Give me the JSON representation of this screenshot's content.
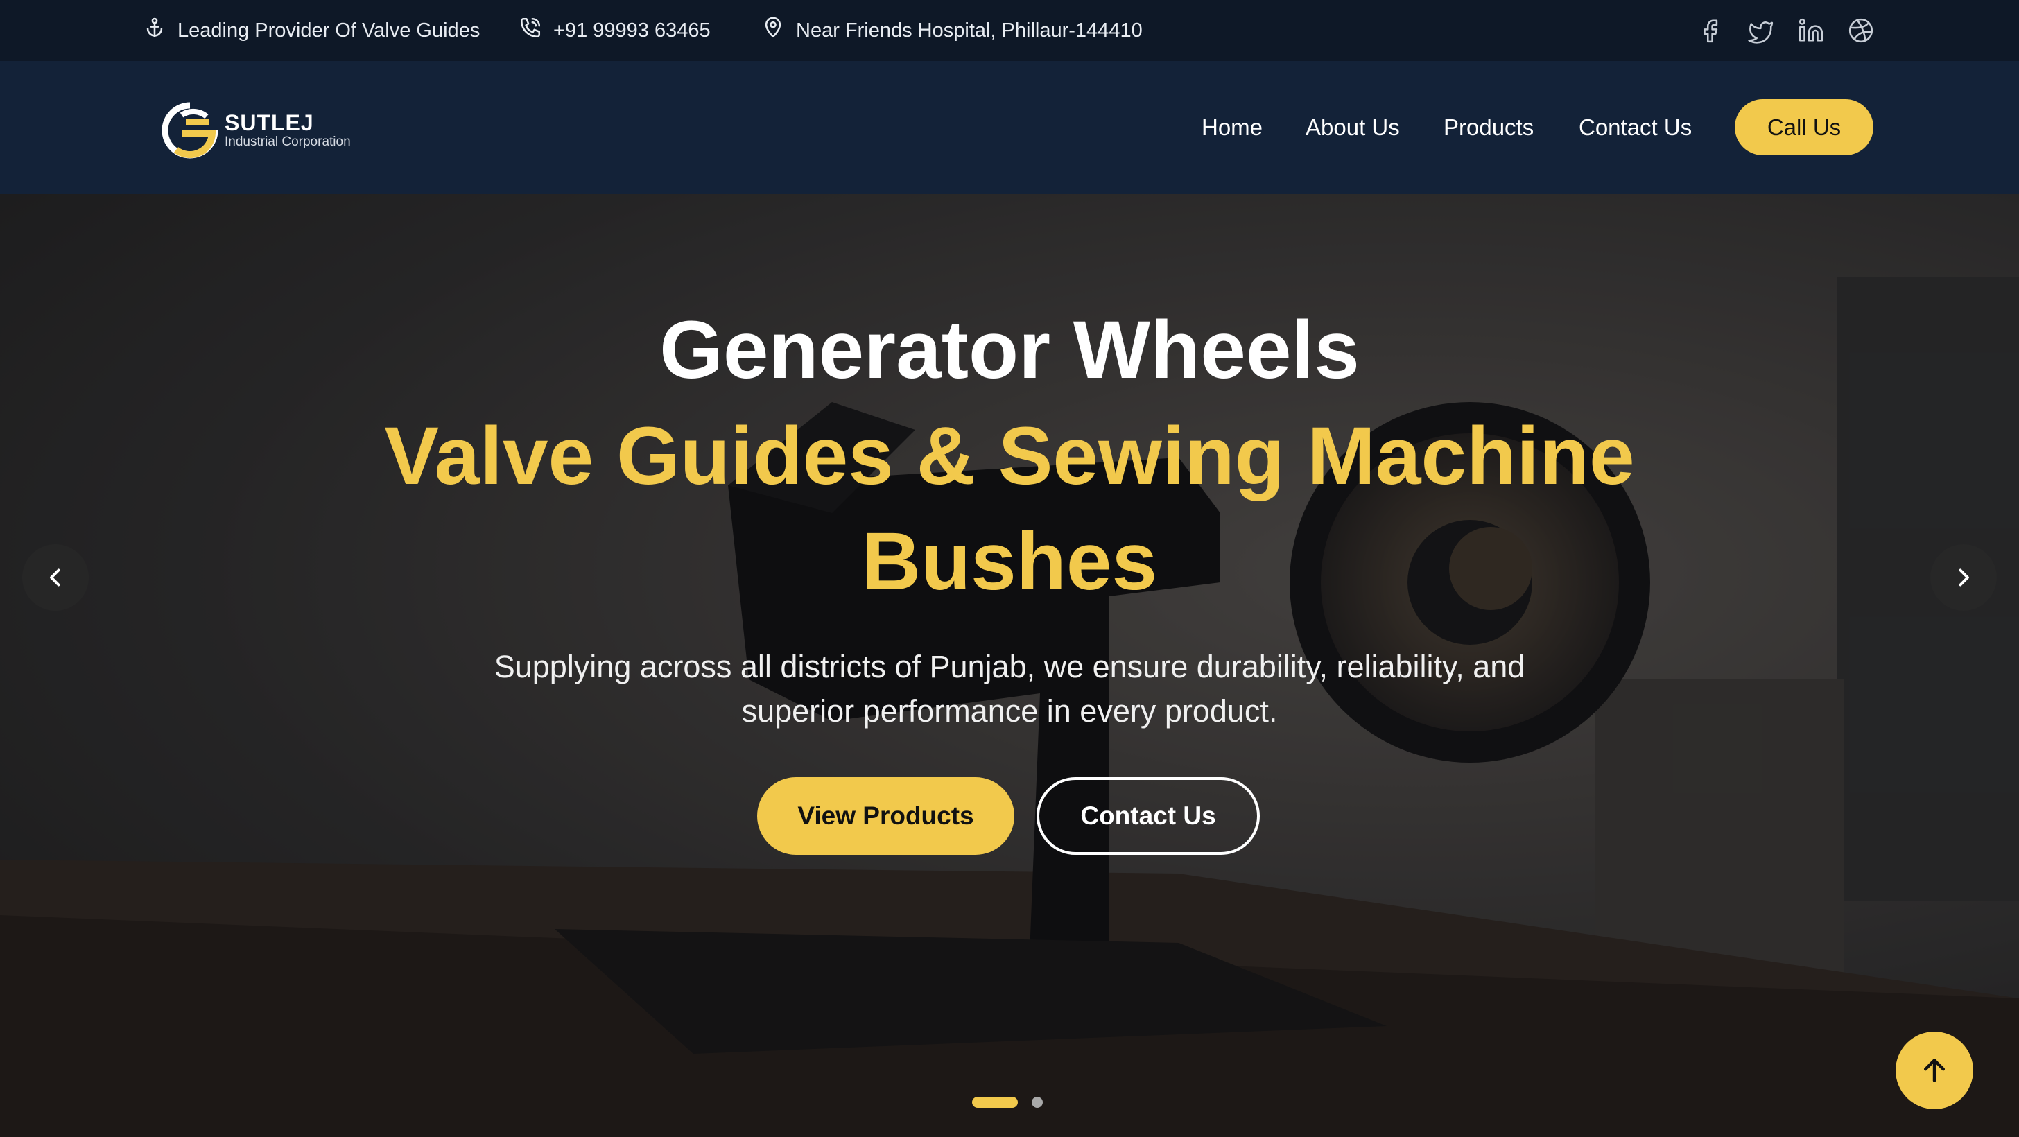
{
  "topbar": {
    "tagline": "Leading Provider Of Valve Guides",
    "phone": "+91 99993 63465",
    "address": "Near Friends Hospital, Phillaur-144410",
    "tagline_icon": "anchor-icon",
    "phone_icon": "phone-icon",
    "address_icon": "map-pin-icon",
    "social": [
      "facebook-icon",
      "twitter-icon",
      "linkedin-icon",
      "dribbble-icon"
    ]
  },
  "header": {
    "logo_name": "SUTLEJ",
    "logo_sub": "Industrial Corporation",
    "nav": [
      {
        "label": "Home"
      },
      {
        "label": "About Us"
      },
      {
        "label": "Products"
      },
      {
        "label": "Contact Us"
      }
    ],
    "cta": "Call Us"
  },
  "hero": {
    "title": "Generator Wheels",
    "subtitle": "Valve Guides & Sewing Machine Bushes",
    "description": "Supplying across all districts of Punjab, we ensure durability, reliability, and superior performance in every product.",
    "primary_button": "View Products",
    "secondary_button": "Contact Us",
    "slide_count": 2,
    "active_slide": 1
  },
  "colors": {
    "accent": "#f2c94c",
    "topbar_bg": "#0e1827",
    "header_bg": "#132238"
  }
}
